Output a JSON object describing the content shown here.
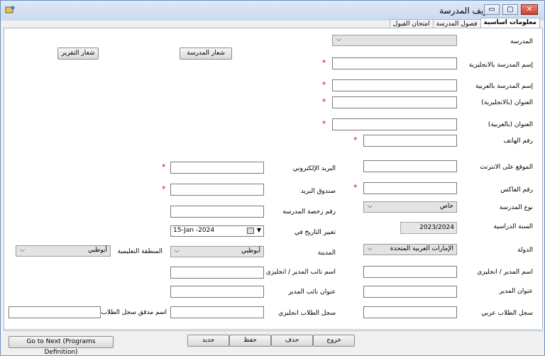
{
  "window": {
    "title": "تعريف المدرسة"
  },
  "tabs": [
    "معلومات اساسية",
    "فصول المدرسة",
    "امتحان القبول"
  ],
  "fields": {
    "school": {
      "label": "المدرسة",
      "value": ""
    },
    "name_en": {
      "label": "إسم المدرسة بالانجليزية",
      "value": ""
    },
    "name_ar": {
      "label": "إسم المدرسة بالعربية",
      "value": ""
    },
    "address_en": {
      "label": "العنوان (بالانجليزية)",
      "value": ""
    },
    "address_ar": {
      "label": "العنوان (بالعربية)",
      "value": ""
    },
    "phone": {
      "label": "رقم الهاتف",
      "value": ""
    },
    "website": {
      "label": "الموقع على الانترنت",
      "value": ""
    },
    "fax": {
      "label": "رقم الفاكس",
      "value": ""
    },
    "school_type": {
      "label": "نوع المدرسة",
      "value": "خاص"
    },
    "academic_year": {
      "label": "السنة الدراسية",
      "value": "2023/2024"
    },
    "country": {
      "label": "الدولة",
      "value": "الإمارات العربية المتحدة"
    },
    "principal_name": {
      "label": "اسم المدير / انجليزي",
      "value": ""
    },
    "principal_address": {
      "label": "عنوان المدير",
      "value": ""
    },
    "arabic_register": {
      "label": "سجل الطلاب عربي",
      "value": ""
    },
    "email": {
      "label": "البريد الإلكتروني",
      "value": ""
    },
    "po_box": {
      "label": "صندوق البريد",
      "value": ""
    },
    "license_no": {
      "label": "رقم رخصة المدرسة",
      "value": ""
    },
    "change_date": {
      "label": "تغيير التاريخ في",
      "value": "15-Jan -2024"
    },
    "city": {
      "label": "المدينة",
      "value": "أبوظبي"
    },
    "vice_name": {
      "label": "اسم نائب المدير / انجليزي",
      "value": ""
    },
    "vice_address": {
      "label": "عنوان نائب المدير",
      "value": ""
    },
    "english_register": {
      "label": "سجل الطلاب انجليزي",
      "value": ""
    },
    "edu_zone": {
      "label": "المنطقة التعليمية",
      "value": "أبوظبي"
    },
    "auditor_name": {
      "label": "اسم مدقق سجل الطلاب",
      "value": ""
    }
  },
  "buttons": {
    "school_logo": "شعار المدرسة",
    "report_logo": "شعار التقرير",
    "next": "Go to Next (Programs Definition)",
    "new": "جديد",
    "save": "حفظ",
    "delete": "حذف",
    "exit": "خروج"
  },
  "required_mark": "*",
  "colors": {
    "required": "#dd0000",
    "title_bar": "#c9daf0",
    "close": "#c7402e"
  }
}
